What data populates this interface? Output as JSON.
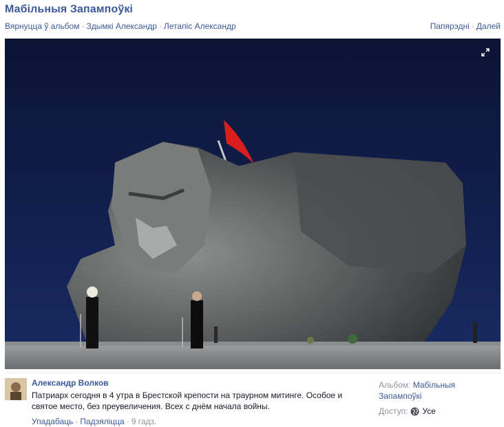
{
  "header": {
    "album_title": "Мабільныя Запампоўкі",
    "nav": {
      "back_to_album": "Вярнуцца ў альбом",
      "photos_of": "Здымкі Александр",
      "timeline_of": "Летапіс Александр",
      "separator": "·",
      "previous": "Папярэдні",
      "next": "Далей"
    }
  },
  "photo": {
    "expand_icon": "expand-arrows-icon"
  },
  "post": {
    "author": "Александр Волков",
    "text": "Патриарх сегодня в 4 утра в Брестской крепости на траурном митинге. Особое и святое место, без преувеличения. Всех с днём начала войны.",
    "actions": {
      "like": "Упадабаць",
      "share": "Падзяліцца",
      "time": "9 гадз."
    }
  },
  "meta": {
    "album_label": "Альбом:",
    "album_name": "Мабільныя Запампоўкі",
    "access_label": "Доступ:",
    "access_value": "Усе",
    "access_icon": "globe-icon"
  },
  "colors": {
    "link": "#3b5998",
    "muted": "#90949c",
    "text": "#141823",
    "sky": "#0e1a3d"
  }
}
